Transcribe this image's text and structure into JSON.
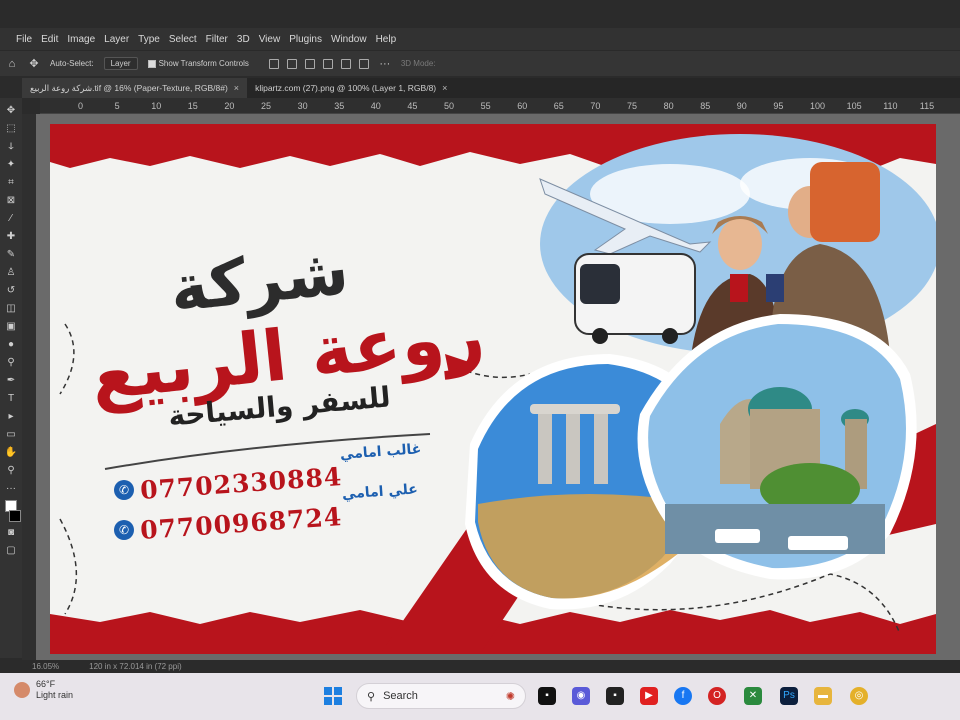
{
  "app": {
    "menu": [
      "File",
      "Edit",
      "Image",
      "Layer",
      "Type",
      "Select",
      "Filter",
      "3D",
      "View",
      "Plugins",
      "Window",
      "Help"
    ],
    "options": {
      "auto_select_label": "Auto-Select:",
      "auto_select_value": "Layer",
      "transform_label": "Show Transform Controls",
      "mode_3d_label": "3D Mode:"
    },
    "tabs": [
      {
        "label": "شركة روعة الربيع.tif @ 16% (Paper-Texture, RGB/8#)"
      },
      {
        "label": "klipartz.com (27).png @ 100% (Layer 1, RGB/8)"
      }
    ],
    "ruler": [
      "0",
      "5",
      "10",
      "15",
      "20",
      "25",
      "30",
      "35",
      "40",
      "45",
      "50",
      "55",
      "60",
      "65",
      "70",
      "75",
      "80",
      "85",
      "90",
      "95",
      "100",
      "105",
      "110",
      "115"
    ],
    "status": {
      "zoom": "16.05%",
      "doc_size": "120 in x 72.014 in (72 ppi)"
    }
  },
  "flyer": {
    "title_line1": "شركة",
    "title_line2": "روعة الربيع",
    "subtitle": "للسفر والسياحة",
    "contacts": [
      {
        "name": "غالب امامي",
        "phone": "07702330884"
      },
      {
        "name": "علي امامي",
        "phone": "07700968724"
      }
    ]
  },
  "taskbar": {
    "weather_temp": "66°F",
    "weather_desc": "Light rain",
    "search_label": "Search"
  },
  "colors": {
    "brand_red": "#b8141c",
    "brand_blue": "#1c5fb0",
    "photoshop_bg": "#2b2b2b"
  }
}
